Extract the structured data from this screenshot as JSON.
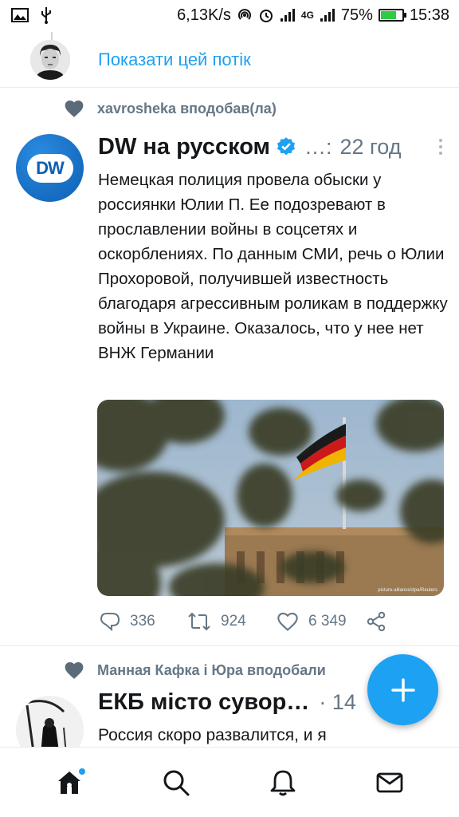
{
  "status_bar": {
    "net_speed": "6,13K/s",
    "network_type": "4G",
    "battery": "75%",
    "battery_level": 0.75,
    "time": "15:38"
  },
  "thread": {
    "show_thread_label": "Показати цей потік"
  },
  "tweet": {
    "social_context": "xavrosheka вподобав(ла)",
    "display_name": "DW на русском",
    "handle": "…:",
    "time": "22 год",
    "avatar_text": "DW",
    "text": "Немецкая полиция провела обыски у россиянки Юлии П. Ее подозревают в прославлении войны в соцсетях и оскорблениях. По данным СМИ, речь о Юлии Прохоровой, получившей известность благодаря агрессивным роликам в поддержку войны в Украине. Оказалось, что у нее нет ВНЖ Германии",
    "media_credit": "picture-alliance/dpa/Reuters",
    "replies": "336",
    "retweets": "924",
    "likes": "6 349"
  },
  "tweet2": {
    "social_context": "Манная Кафка і Юра вподобали",
    "display_name": "ЕКБ місто сувор…",
    "time": "· 14",
    "text": "Россия скоро развалится, и я"
  },
  "colors": {
    "accent": "#1da1f2",
    "secondary_text": "#657786",
    "divider": "#e6ecf0"
  },
  "icons": {
    "nav": [
      "home-icon",
      "search-icon",
      "notifications-icon",
      "messages-icon"
    ]
  }
}
